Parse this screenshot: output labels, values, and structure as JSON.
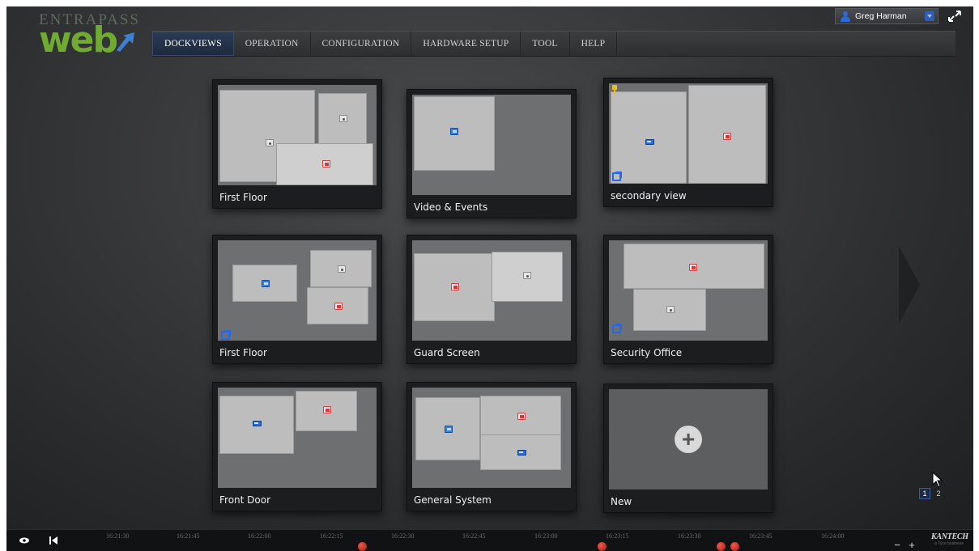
{
  "app": {
    "logo": {
      "top": "ENTRAPASS",
      "main": "web"
    },
    "nav": [
      "DOCKVIEWS",
      "OPERATION",
      "CONFIGURATION",
      "HARDWARE SETUP",
      "TOOL",
      "HELP"
    ],
    "active_nav": "DOCKVIEWS",
    "user": {
      "name": "Greg Harman"
    }
  },
  "dockviews": [
    {
      "label": "First Floor"
    },
    {
      "label": "Video & Events"
    },
    {
      "label": "secondary view"
    },
    {
      "label": "First Floor"
    },
    {
      "label": "Guard Screen"
    },
    {
      "label": "Security Office"
    },
    {
      "label": "Front Door"
    },
    {
      "label": "General System"
    },
    {
      "label": "New"
    }
  ],
  "new_tile": {
    "plus": "+"
  },
  "pager": {
    "pages": [
      "1",
      "2"
    ],
    "current": "1"
  },
  "timeline": {
    "ticks": [
      "16:21:30",
      "16:21:45",
      "16:22:00",
      "16:22:15",
      "16:22:30",
      "16:22:45",
      "16:23:00",
      "16:23:15",
      "16:23:30",
      "16:23:45",
      "16:24:00"
    ],
    "zoom_out": "−",
    "zoom_in": "+",
    "brand": {
      "name": "KANTECH",
      "sub": "a Tyco business"
    }
  }
}
